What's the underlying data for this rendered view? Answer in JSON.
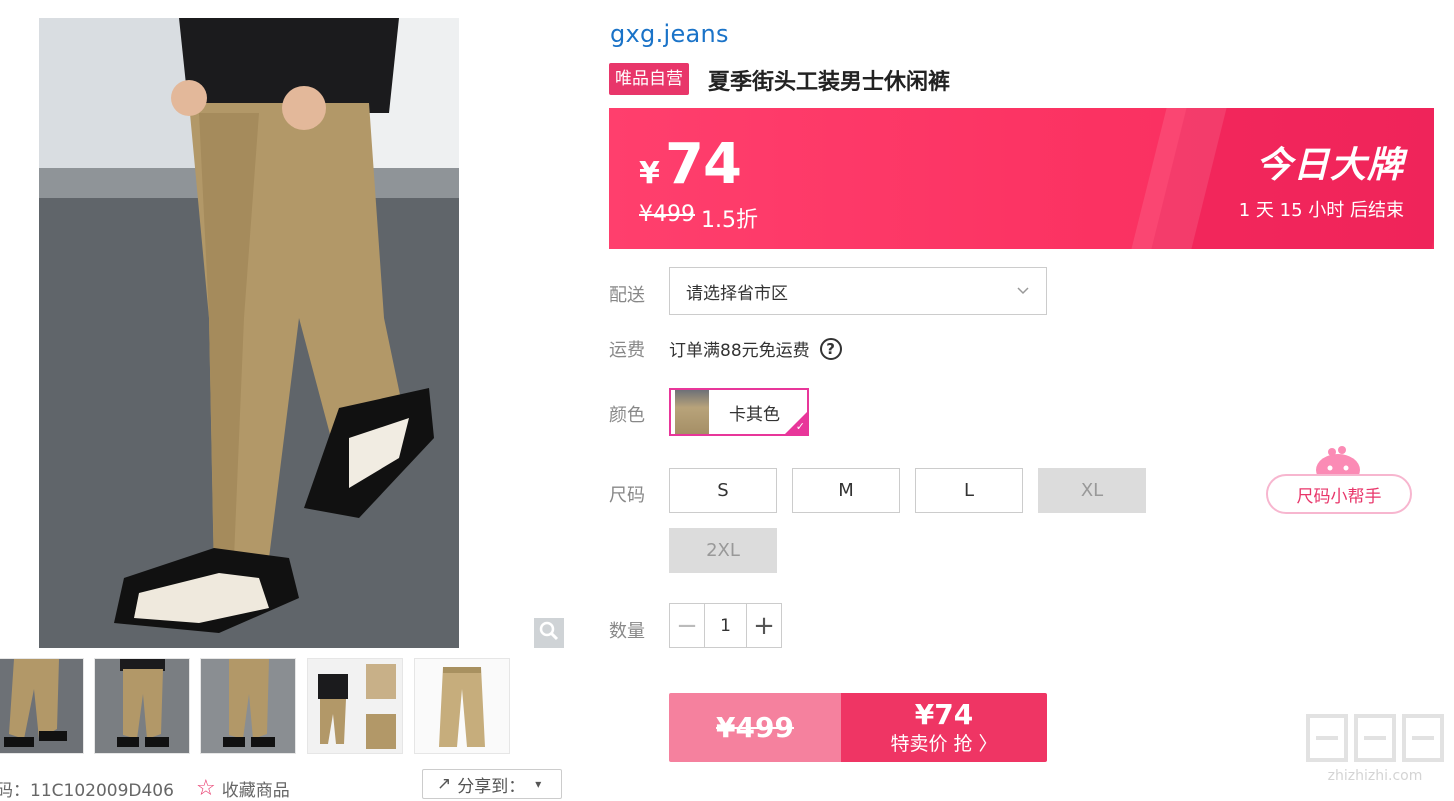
{
  "gallery": {
    "thumbnails": [
      "thumb-1",
      "thumb-2",
      "thumb-3",
      "thumb-4",
      "thumb-5"
    ],
    "product_code": "码：11C102009D406",
    "favorite_label": "收藏商品",
    "share_label": "分享到："
  },
  "product": {
    "brand": "gxg.jeans",
    "badge": "唯品自营",
    "title": "夏季街头工装男士休闲裤"
  },
  "price": {
    "currency": "¥",
    "current": "74",
    "original": "¥499",
    "discount": "1.5折",
    "campaign": "今日大牌",
    "countdown": "1  天  15  小时  后结束"
  },
  "delivery": {
    "label": "配送",
    "placeholder": "请选择省市区"
  },
  "freight": {
    "label": "运费",
    "text": "订单满88元免运费"
  },
  "color": {
    "label": "颜色",
    "selected": "卡其色"
  },
  "size": {
    "label": "尺码",
    "options": [
      {
        "name": "S",
        "available": true
      },
      {
        "name": "M",
        "available": true
      },
      {
        "name": "L",
        "available": true
      },
      {
        "name": "XL",
        "available": false
      },
      {
        "name": "2XL",
        "available": false
      }
    ],
    "helper": "尺码小帮手"
  },
  "quantity": {
    "label": "数量",
    "value": "1"
  },
  "buy": {
    "original": "¥499",
    "price": "¥74",
    "action": "特卖价 抢 〉"
  },
  "colors": {
    "accent": "#ef3564",
    "brand_link": "#1a73c8",
    "badge": "#e8366a"
  }
}
